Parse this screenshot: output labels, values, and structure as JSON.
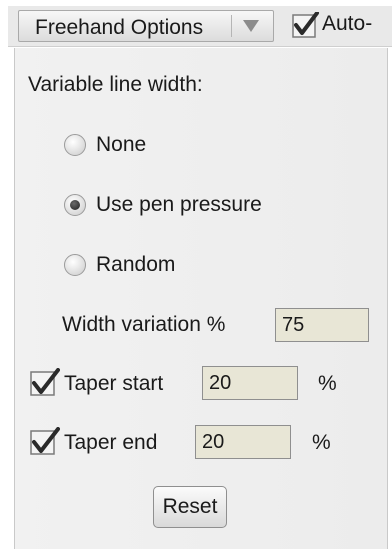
{
  "header": {
    "dropdown_label": "Freehand Options",
    "auto_label": "Auto-",
    "auto_checked": true
  },
  "panel": {
    "variable_width_label": "Variable line width:",
    "radio_options": [
      {
        "label": "None",
        "checked": false
      },
      {
        "label": "Use pen pressure",
        "checked": true
      },
      {
        "label": "Random",
        "checked": false
      }
    ],
    "width_variation_label": "Width variation %",
    "width_variation_value": "75",
    "taper_start": {
      "label": "Taper start",
      "checked": true,
      "value": "20",
      "unit": "%"
    },
    "taper_end": {
      "label": "Taper end",
      "checked": true,
      "value": "20",
      "unit": "%"
    },
    "reset_label": "Reset"
  }
}
